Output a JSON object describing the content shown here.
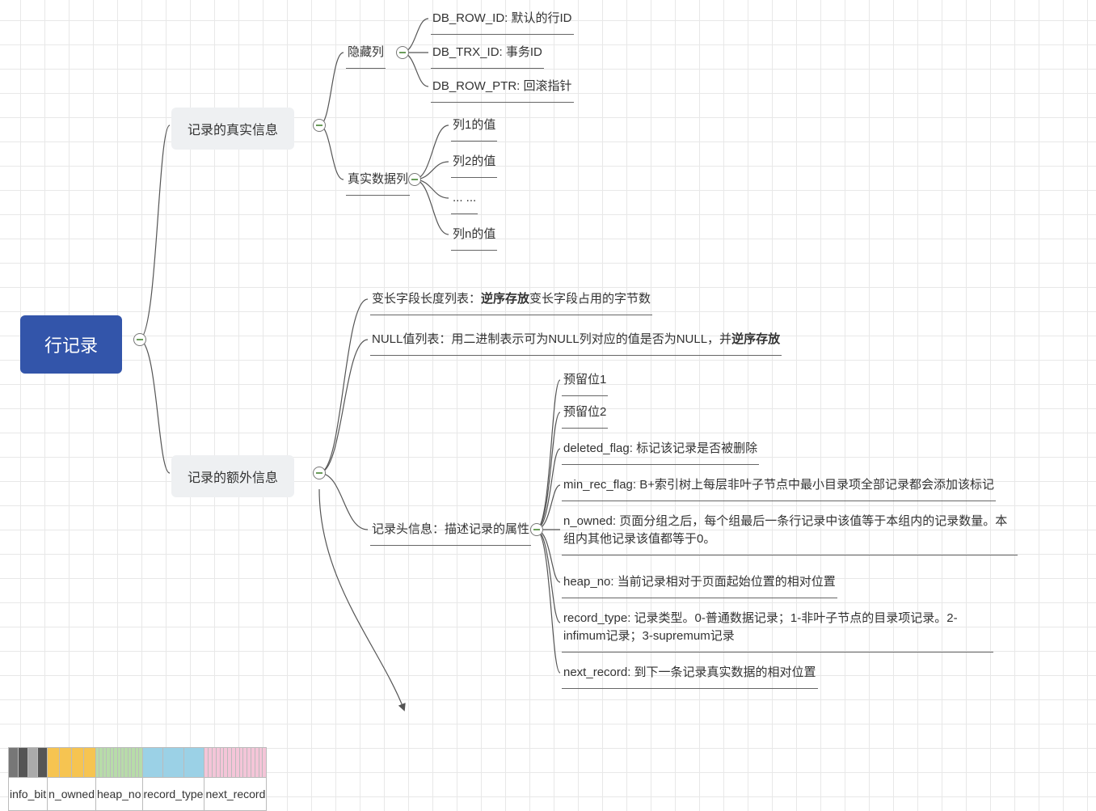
{
  "root": "行记录",
  "real": "记录的真实信息",
  "extra": "记录的额外信息",
  "hidden_label": "隐藏列",
  "hidden": [
    "DB_ROW_ID: 默认的行ID",
    "DB_TRX_ID: 事务ID",
    "DB_ROW_PTR: 回滚指针"
  ],
  "datacol_label": "真实数据列",
  "datacol": [
    "列1的值",
    "列2的值",
    "... ...",
    "列n的值"
  ],
  "varlen": {
    "pre": "变长字段长度列表：",
    "b": "逆序存放",
    "post": "变长字段占用的字节数"
  },
  "nulllist": {
    "pre": "NULL值列表：用二进制表示可为NULL列对应的值是否为NULL，并",
    "b": "逆序存放"
  },
  "header_label": "记录头信息：描述记录的属性",
  "header": [
    "预留位1",
    "预留位2",
    "deleted_flag: 标记该记录是否被删除",
    "min_rec_flag: B+索引树上每层非叶子节点中最小目录项全部记录都会添加该标记",
    "n_owned: 页面分组之后，每个组最后一条行记录中该值等于本组内的记录数量。本组内其他记录该值都等于0。",
    "heap_no: 当前记录相对于页面起始位置的相对位置",
    "record_type: 记录类型。0-普通数据记录；1-非叶子节点的目录项记录。2-infimum记录；3-supremum记录",
    "next_record: 到下一条记录真实数据的相对位置"
  ],
  "table_labels": [
    "info_bit",
    "n_owned",
    "heap_no",
    "record_type",
    "next_record"
  ],
  "bits": {
    "info": [
      "#777",
      "#555",
      "#aaa",
      "#555"
    ],
    "owned": 4,
    "heap": 13,
    "type": 3,
    "next": 16
  },
  "colors": {
    "owned": "#f6c451",
    "heap": "#b7dca9",
    "type": "#9bd1e6",
    "next": "#f4c5d8"
  }
}
